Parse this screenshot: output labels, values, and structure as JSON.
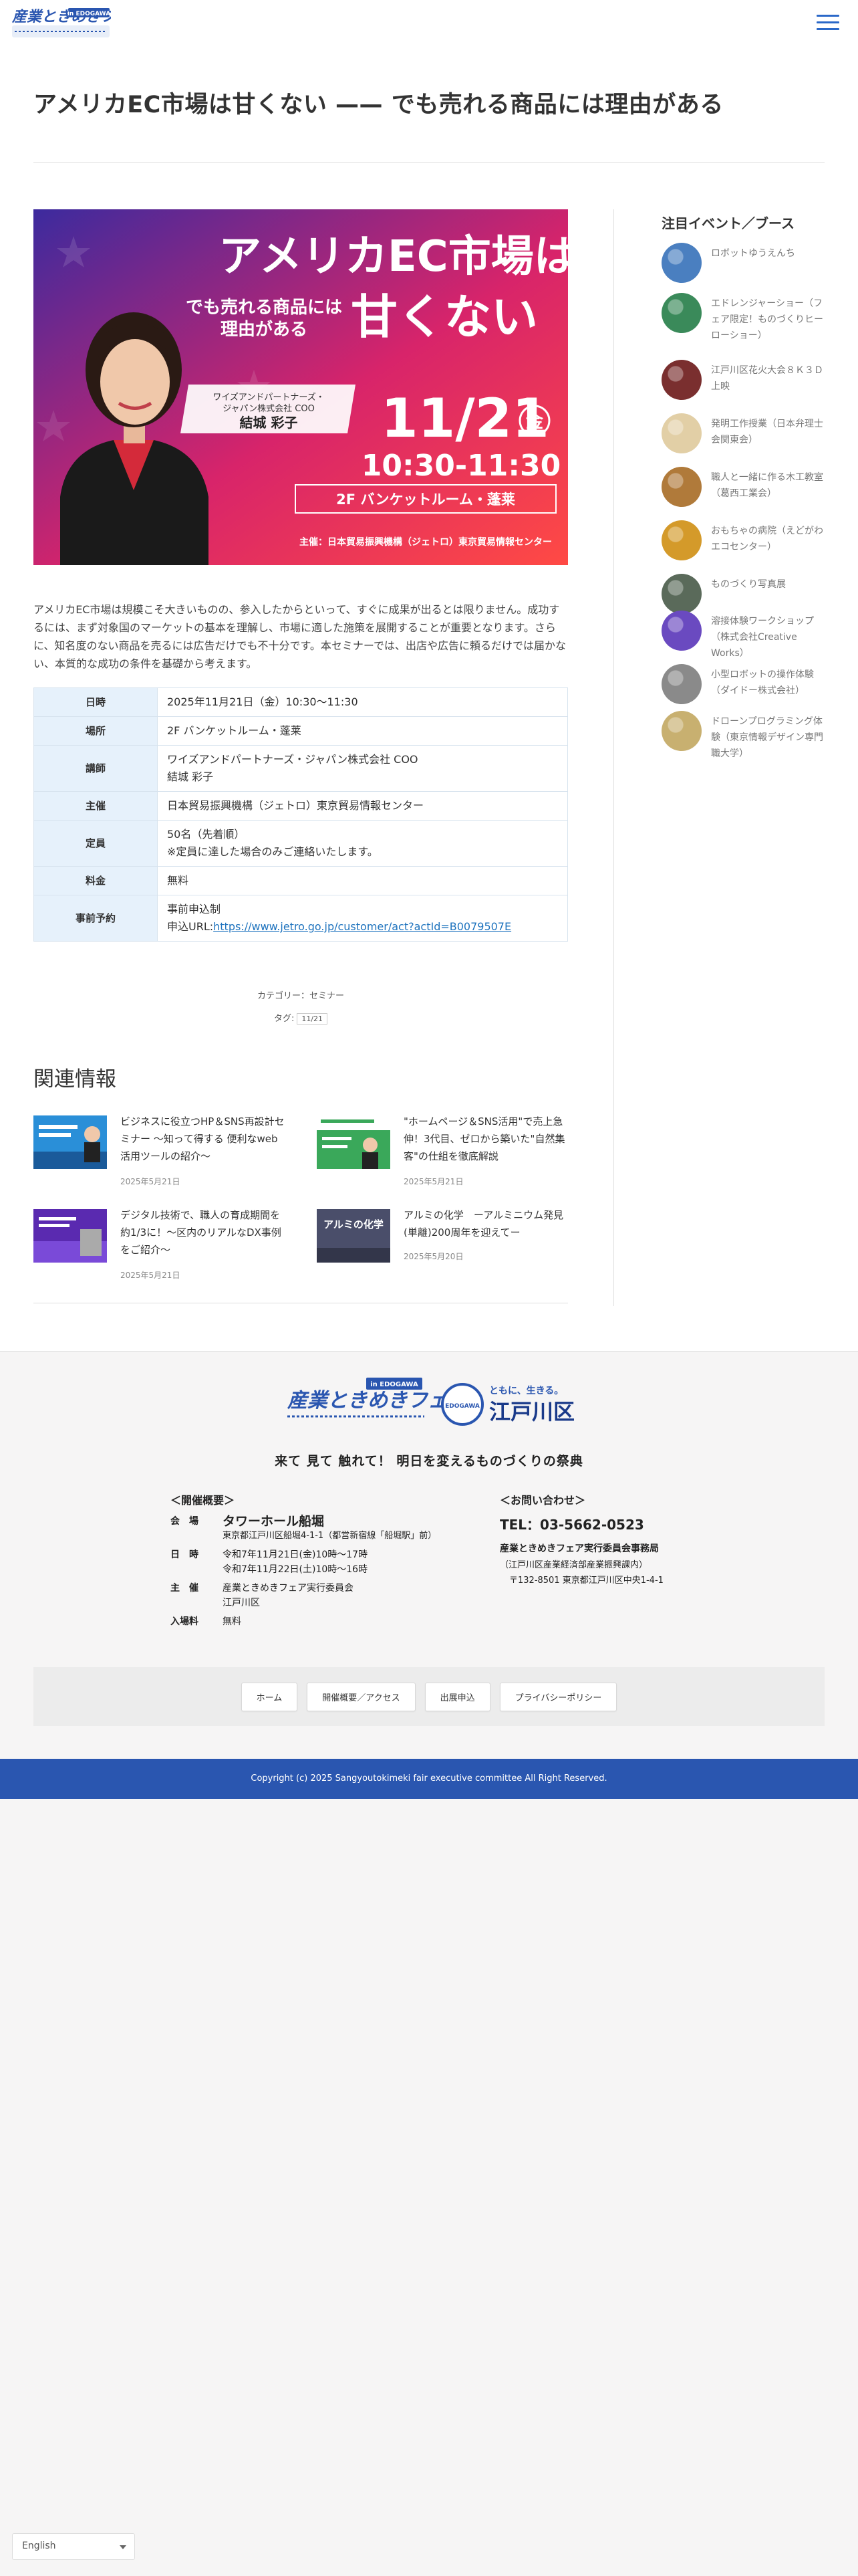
{
  "header": {
    "logo_main": "産業ときめきフェア",
    "logo_sub": "in EDOGAWA"
  },
  "article": {
    "title": "アメリカEC市場は甘くない —— でも売れる商品には理由がある",
    "hero": {
      "headline1": "アメリカEC市場は",
      "headline2": "甘くない",
      "sub1": "でも売れる商品には",
      "sub2": "理由がある",
      "speaker_title1": "ワイズアンドパートナーズ・",
      "speaker_title2": "ジャパン株式会社 COO",
      "speaker_name": "結城 彩子",
      "date": "11/21",
      "weekday": "金",
      "time": "10:30-11:30",
      "room": "2F バンケットルーム・蓬莱",
      "organizer": "主催：日本貿易振興機構（ジェトロ）東京貿易情報センター",
      "colors": {
        "grad_start": "#3c2a9e",
        "grad_end": "#ff4a44"
      }
    },
    "intro": "アメリカEC市場は規模こそ大きいものの、参入したからといって、すぐに成果が出るとは限りません。成功するには、まず対象国のマーケットの基本を理解し、市場に適した施策を展開することが重要となります。さらに、知名度のない商品を売るには広告だけでも不十分です。本セミナーでは、出店や広告に頼るだけでは届かない、本質的な成功の条件を基礎から考えます。",
    "details": [
      {
        "label": "日時",
        "value": "2025年11月21日（金）10:30〜11:30"
      },
      {
        "label": "場所",
        "value": "2F バンケットルーム・蓬莱"
      },
      {
        "label": "講師",
        "value": "ワイズアンドパートナーズ・ジャパン株式会社 COO",
        "value2": "結城 彩子"
      },
      {
        "label": "主催",
        "value": "日本貿易振興機構（ジェトロ）東京貿易情報センター"
      },
      {
        "label": "定員",
        "value": "50名（先着順）",
        "value2": "※定員に達した場合のみご連絡いたします。"
      },
      {
        "label": "料金",
        "value": "無料"
      },
      {
        "label": "事前予約",
        "value": "事前申込制",
        "value2_prefix": "申込URL:",
        "link": "https://www.jetro.go.jp/customer/act?actId=B0079507E"
      }
    ],
    "category": "カテゴリー：セミナー",
    "tag_label": "タグ:",
    "tag": "11/21"
  },
  "related": {
    "heading": "関連情報",
    "items": [
      {
        "title": "ビジネスに役立つHP＆SNS再設計セミナー 〜知って得する 便利なweb活用ツールの紹介〜",
        "date": "2025年5月21日"
      },
      {
        "title": "\"ホームページ＆SNS活用\"で売上急伸！3代目、ゼロから築いた\"自然集客\"の仕組を徹底解説",
        "date": "2025年5月21日"
      },
      {
        "title": "デジタル技術で、職人の育成期間を約1/3に！〜区内のリアルなDX事例をご紹介〜",
        "date": "2025年5月21日"
      },
      {
        "title": "アルミの化学　ーアルミニウム発見(単離)200周年を迎えてー",
        "date": "2025年5月20日"
      }
    ],
    "thumb_text": {
      "item4": "アルミの化学"
    }
  },
  "sidebar": {
    "heading": "注目イベント／ブース",
    "items": [
      {
        "label": "ロボットゆうえんち",
        "color": "#4a7fc0"
      },
      {
        "label": "エドレンジャーショー（フェア限定！ものづくりヒーローショー）",
        "color": "#3a8a5a"
      },
      {
        "label": "江戸川区花火大会８Ｋ３Ｄ上映",
        "color": "#7a2f2f"
      },
      {
        "label": "発明工作授業（日本弁理士会関東会）",
        "color": "#e2cfa6"
      },
      {
        "label": "職人と一緒に作る木工教室（葛西工業会）",
        "color": "#b07a3a"
      },
      {
        "label": "おもちゃの病院（えどがわエコセンター）",
        "color": "#d49a2a"
      },
      {
        "label": "ものづくり写真展",
        "color": "#5a6a5a"
      },
      {
        "label": "溶接体験ワークショップ（株式会社Creative Works）",
        "color": "#6a4ac0"
      },
      {
        "label": "小型ロボットの操作体験（ダイドー株式会社）",
        "color": "#8a8a8a"
      },
      {
        "label": "ドローンプログラミング体験（東京情報デザイン専門職大学）",
        "color": "#c8b070"
      }
    ]
  },
  "footer": {
    "logo_main": "産業ときめきフェア",
    "logo_sub": "in EDOGAWA",
    "city_slogan": "ともに、生きる。",
    "city_name": "江戸川区",
    "city_badge": "EDOGAWA",
    "tagline": "来て 見て 触れて！ 明日を変えるものづくりの祭典",
    "overview": {
      "heading": "＜開催概要＞",
      "venue_label": "会　場",
      "venue": "タワーホール船堀",
      "address": "東京都江戸川区船堀4-1-1（都営新宿線「船堀駅」前）",
      "dates_label": "日　時",
      "date1": "令和7年11月21日(金)10時〜17時",
      "date2": "令和7年11月22日(土)10時〜16時",
      "organizer_label": "主　催",
      "organizer1": "産業ときめきフェア実行委員会",
      "organizer2": "江戸川区",
      "fee_label": "入場料",
      "fee": "無料"
    },
    "contact": {
      "heading": "＜お問い合わせ＞",
      "tel": "TEL：03-5662-0523",
      "office": "産業ときめきフェア実行委員会事務局",
      "dept": "（江戸川区産業経済部産業振興課内）",
      "address": "〒132-8501 東京都江戸川区中央1-4-1"
    },
    "nav": [
      "ホーム",
      "開催概要／アクセス",
      "出展申込",
      "プライバシーポリシー"
    ],
    "copyright": "Copyright (c) 2025 Sangyoutokimeki fair executive committee All Right Reserved."
  },
  "language": {
    "selected": "English"
  }
}
